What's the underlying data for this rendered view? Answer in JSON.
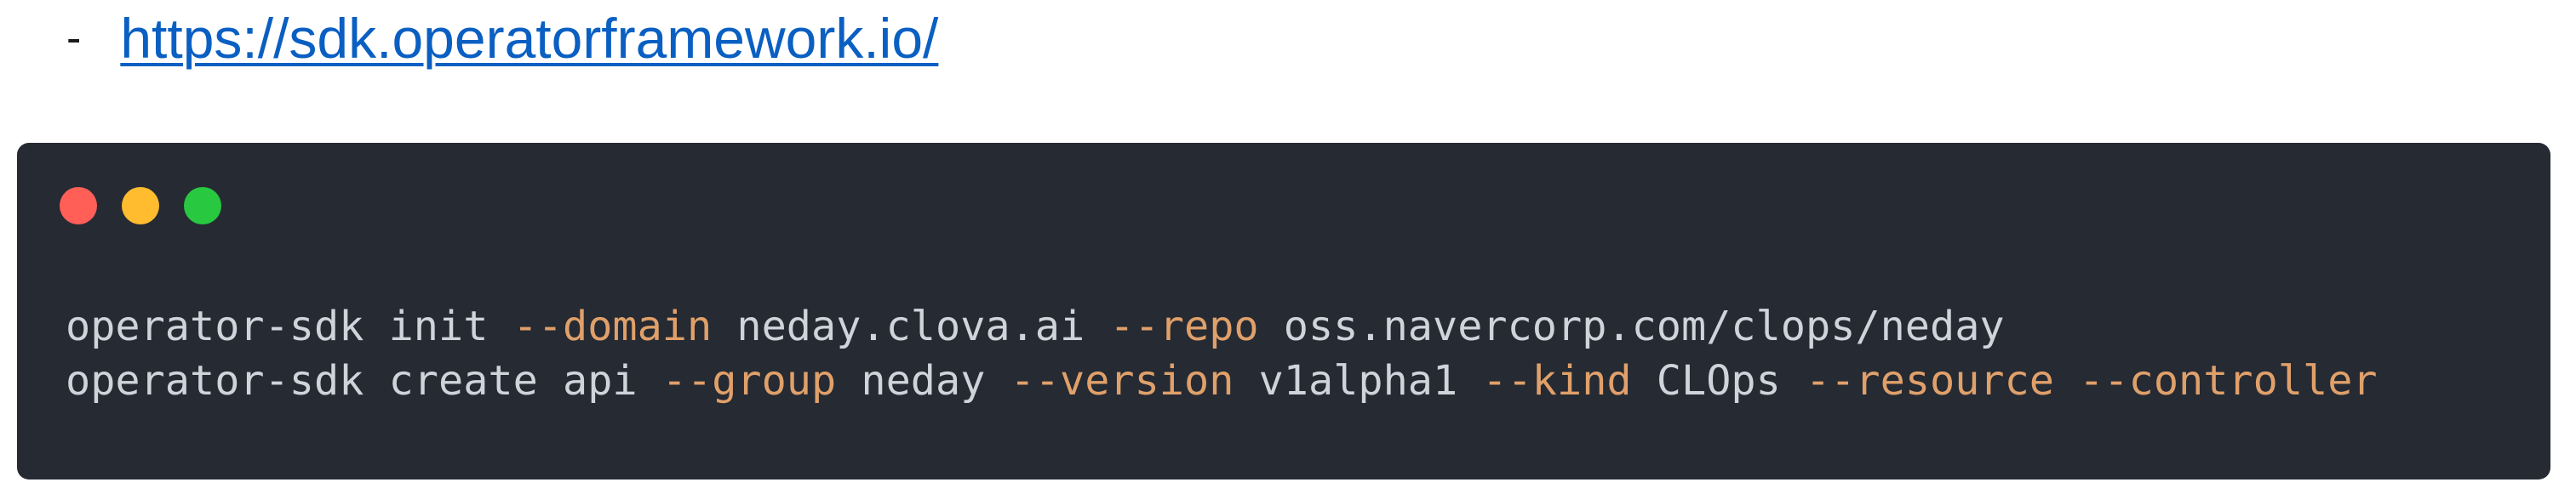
{
  "link_item": {
    "bullet": "-",
    "url_text": "https://sdk.operatorframework.io/"
  },
  "window_controls": {
    "close_color": "#ff5f57",
    "minimize_color": "#febc2e",
    "maximize_color": "#28c840"
  },
  "code": {
    "line1": {
      "t1": "operator-sdk init ",
      "f1": "--domain",
      "t2": " neday.clova.ai ",
      "f2": "--repo",
      "t3": " oss.navercorp.com/clops/neday"
    },
    "line2": {
      "t1": "operator-sdk create api ",
      "f1": "--group",
      "t2": " neday ",
      "f2": "--version",
      "t3": " v1alpha1 ",
      "f3": "--kind",
      "t4": " CLOps ",
      "f4": "--resource",
      "t5": " ",
      "f5": "--controller"
    }
  },
  "colors": {
    "code_background": "#252a33",
    "code_text": "#cfd4db",
    "flag_text": "#e0a06a",
    "link": "#0a5fc2"
  }
}
